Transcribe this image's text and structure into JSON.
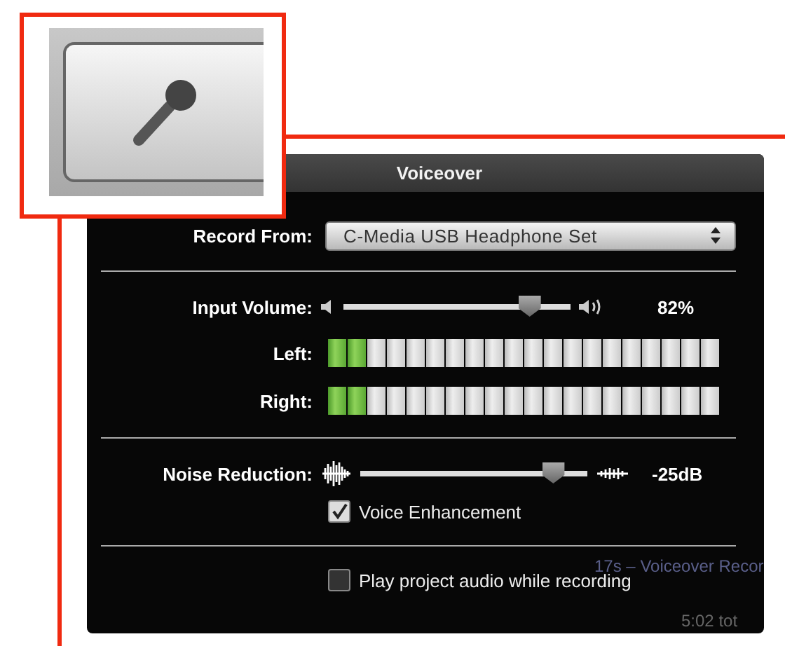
{
  "panel": {
    "title": "Voiceover"
  },
  "record_from": {
    "label": "Record From:",
    "value": "C-Media USB Headphone Set"
  },
  "input_volume": {
    "label": "Input Volume:",
    "level": 0.82,
    "reading": "82%"
  },
  "meters": [
    {
      "label": "Left:",
      "level": 0.1
    },
    {
      "label": "Right:",
      "level": 0.1
    }
  ],
  "noise_reduction": {
    "label": "Noise Reduction:",
    "level": 0.85,
    "reading": "-25dB"
  },
  "checkboxes": [
    {
      "label": "Voice Enhancement",
      "checked": true
    },
    {
      "label": "Play project audio while recording",
      "checked": false
    }
  ],
  "background": {
    "clip_title": "17s – Voiceover Recor",
    "total_time": "5:02 tot"
  }
}
